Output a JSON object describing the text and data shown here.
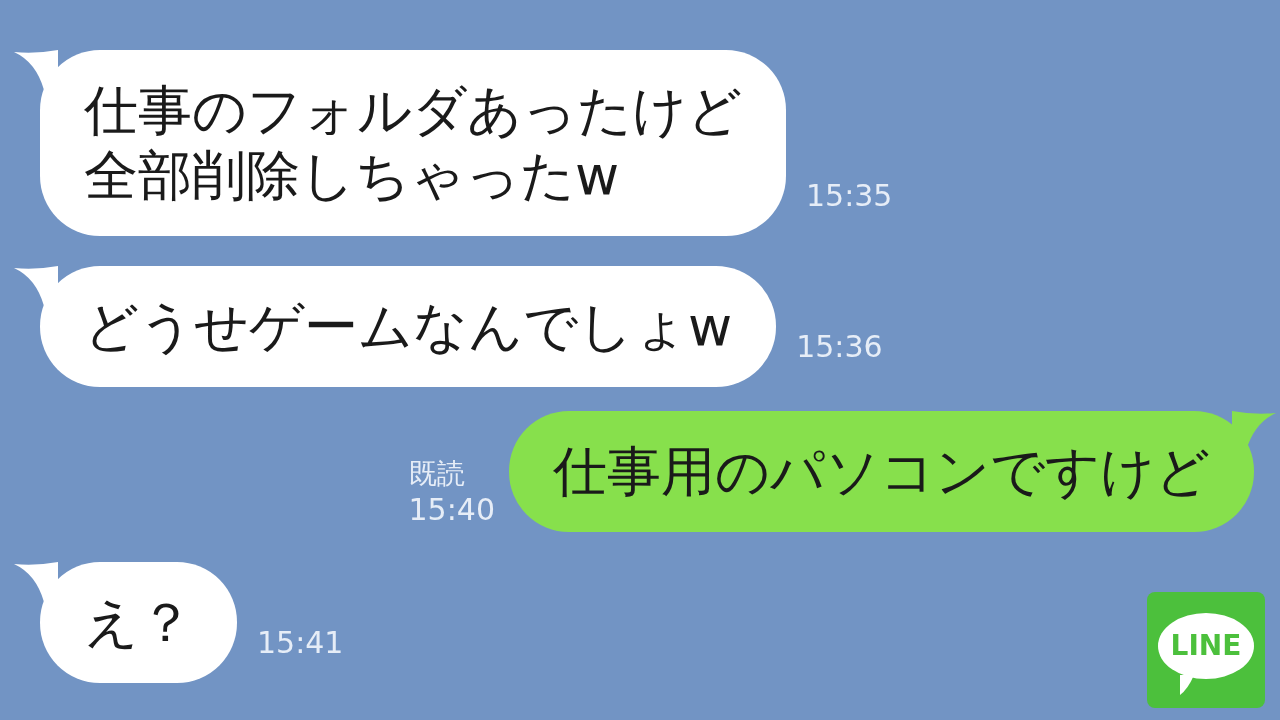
{
  "messages": [
    {
      "kind": "incoming",
      "lines": [
        "仕事のフォルダあったけど",
        "全部削除しちゃったw"
      ],
      "time": "15:35"
    },
    {
      "kind": "incoming",
      "lines": [
        "どうせゲームなんでしょw"
      ],
      "time": "15:36"
    },
    {
      "kind": "outgoing",
      "lines": [
        "仕事用のパソコンですけど"
      ],
      "read_label": "既読",
      "time": "15:40"
    },
    {
      "kind": "incoming",
      "lines": [
        "え？"
      ],
      "time": "15:41"
    }
  ],
  "logo": {
    "text": "LINE"
  }
}
